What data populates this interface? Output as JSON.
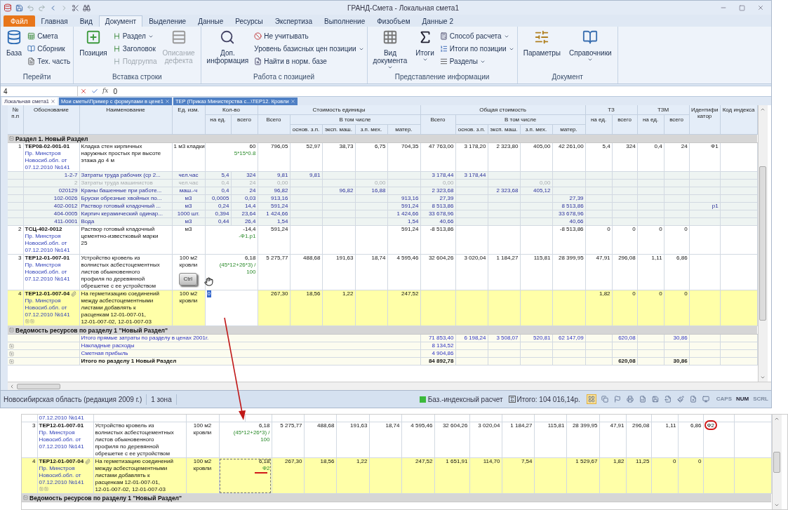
{
  "window": {
    "title": "ГРАНД-Смета - Локальная смета1"
  },
  "file_menu": {
    "label": "Файл"
  },
  "menu_tabs": [
    {
      "label": "Главная",
      "selected": false
    },
    {
      "label": "Вид",
      "selected": false
    },
    {
      "label": "Документ",
      "selected": true
    },
    {
      "label": "Выделение",
      "selected": false
    },
    {
      "label": "Данные",
      "selected": false
    },
    {
      "label": "Ресурсы",
      "selected": false
    },
    {
      "label": "Экспертиза",
      "selected": false
    },
    {
      "label": "Выполнение",
      "selected": false
    },
    {
      "label": "Физобъем",
      "selected": false
    },
    {
      "label": "Данные 2",
      "selected": false
    }
  ],
  "ribbon": [
    {
      "title": "Перейти",
      "large": [
        {
          "label": [
            "База"
          ],
          "disabled": false,
          "dropdown": false
        }
      ],
      "small": [
        {
          "label": "Смета",
          "disabled": false,
          "dropdown": false
        },
        {
          "label": "Сборник",
          "disabled": false,
          "dropdown": false
        },
        {
          "label": "Тех. часть",
          "disabled": false,
          "dropdown": false
        }
      ]
    },
    {
      "title": "Вставка строки",
      "large": [
        {
          "label": [
            "Позиция"
          ],
          "disabled": false,
          "dropdown": false
        }
      ],
      "small": [
        {
          "label": "Раздел",
          "disabled": false,
          "dropdown": true
        },
        {
          "label": "Заголовок",
          "disabled": false,
          "dropdown": false
        },
        {
          "label": "Подгруппа",
          "disabled": true,
          "dropdown": false
        }
      ],
      "large_after": [
        {
          "label": [
            "Описание",
            "дефекта"
          ],
          "disabled": true,
          "dropdown": false
        }
      ]
    },
    {
      "title": "Работа с позицией",
      "large": [
        {
          "label": [
            "Доп.",
            "информация"
          ],
          "disabled": false,
          "dropdown": false
        }
      ],
      "small": [
        {
          "label": "Не учитывать",
          "disabled": false,
          "dropdown": false
        },
        {
          "label": "Уровень базисных цен позиции",
          "disabled": false,
          "dropdown": true
        },
        {
          "label": "Найти в норм. базе",
          "disabled": false,
          "dropdown": false
        }
      ]
    },
    {
      "title": "Представление информации",
      "large": [
        {
          "label": [
            "Вид",
            "документа"
          ],
          "disabled": false,
          "dropdown": true
        },
        {
          "label": [
            "Итоги"
          ],
          "disabled": false,
          "dropdown": true
        }
      ],
      "small": [
        {
          "label": "Способ расчета",
          "disabled": false,
          "dropdown": true
        },
        {
          "label": "Итоги по позиции",
          "disabled": false,
          "dropdown": true
        },
        {
          "label": "Разделы",
          "disabled": false,
          "dropdown": true
        }
      ]
    },
    {
      "title": "Документ",
      "large": [
        {
          "label": [
            "Параметры"
          ],
          "disabled": false,
          "dropdown": false
        },
        {
          "label": [
            "Справочники"
          ],
          "disabled": false,
          "dropdown": true
        }
      ]
    }
  ],
  "formula_bar": {
    "cell": "4",
    "function_label": "fx",
    "value": "0"
  },
  "doc_tabs": [
    {
      "label": "Локальная смета1",
      "selected": true
    },
    {
      "label": "Мои сметы\\Пример с формулами в цене1",
      "selected": false
    },
    {
      "label": "ТЕР (Приказ Министерства с...\\ТЕР12. Кровли",
      "selected": false
    }
  ],
  "header": {
    "num": "№ п.п",
    "basis": "Обоснование",
    "name": "Наименование",
    "unit": "Ед. изм.",
    "qty": {
      "label": "Кол-во",
      "sub": [
        "на ед.",
        "всего"
      ]
    },
    "unit_cost": {
      "label": "Стоимость единицы",
      "total": "Всего",
      "incl": "В том числе",
      "sub": [
        "основ. з.п.",
        "эксп. маш.",
        "з.п. мех.",
        "матер."
      ]
    },
    "total_cost": {
      "label": "Общая стоимость",
      "total": "Всего",
      "incl": "В том числе",
      "sub": [
        "основ. з.п.",
        "эксп. маш.",
        "з.п. мех.",
        "матер."
      ]
    },
    "tz": {
      "label": "ТЗ",
      "sub": [
        "на ед.",
        "всего"
      ]
    },
    "tzm": {
      "label": "ТЗМ",
      "sub": [
        "на ед.",
        "всего"
      ]
    },
    "ident": [
      "Идентифи",
      "катор"
    ],
    "code": "Код индекса"
  },
  "main": {
    "rows": [
      {
        "kind": "section",
        "label": "Раздел 1. Новый Раздел",
        "selected": false
      },
      {
        "kind": "item",
        "selected": false,
        "num": "1",
        "code": "ТЕР08-02-001-01",
        "source": [
          "Пр. Минстроя",
          "Новосиб.обл. от",
          "07.12.2010 №141"
        ],
        "name": [
          "Кладка стен кирпичных",
          "наружных простых при высоте",
          "этажа до 4 м"
        ],
        "unit": [
          "1 м3 кладки"
        ],
        "qt": "60",
        "formula": [
          "5*15*0.8"
        ],
        "v": {
          "ut": "796,05",
          "uo": "52,97",
          "ue": "38,73",
          "uz": "6,75",
          "um": "704,35",
          "tt": "47 763,00",
          "to": "3 178,20",
          "te": "2 323,80",
          "tz": "405,00",
          "tm": "42 261,00",
          "zu": "5,4",
          "zt": "324",
          "mu": "0,4",
          "mt": "24",
          "id": "Ф1"
        }
      },
      {
        "kind": "resource",
        "selected": false,
        "disabled": false,
        "code": "1-2-7",
        "name": "Затраты труда рабочих (ср 2...",
        "unit": "чел.час",
        "v": {
          "qu": "5,4",
          "qt": "324",
          "ut": "9,81",
          "uo": "9,81",
          "tt": "3 178,44",
          "to": "3 178,44"
        }
      },
      {
        "kind": "resource",
        "selected": false,
        "disabled": true,
        "code": "2",
        "name": "Затраты труда машинистов",
        "unit": "чел.час",
        "v": {
          "qu": "0,4",
          "qt": "24",
          "ut": "0,00",
          "uz": "0,00",
          "tt": "0,00",
          "tz": "0,00"
        }
      },
      {
        "kind": "resource",
        "selected": false,
        "disabled": false,
        "code": "020129",
        "name": "Краны башенные при работе...",
        "unit": "маш.-ч",
        "v": {
          "qu": "0,4",
          "qt": "24",
          "ut": "96,82",
          "ue": "96,82",
          "uz": "16,88",
          "tt": "2 323,68",
          "te": "2 323,68",
          "tz": "405,12"
        }
      },
      {
        "kind": "resource",
        "selected": false,
        "disabled": false,
        "code": "102-0026",
        "name": "Бруски обрезные хвойных по...",
        "unit": "м3",
        "v": {
          "qu": "0,0005",
          "qt": "0,03",
          "ut": "913,16",
          "um": "913,16",
          "tt": "27,39",
          "tm": "27,39"
        }
      },
      {
        "kind": "resource",
        "selected": false,
        "disabled": false,
        "code": "402-0012",
        "name": "Раствор готовый кладочный ...",
        "unit": "м3",
        "v": {
          "qu": "0,24",
          "qt": "14,4",
          "ut": "591,24",
          "um": "591,24",
          "tt": "8 513,86",
          "tm": "8 513,86",
          "id": "р1"
        }
      },
      {
        "kind": "resource",
        "selected": false,
        "disabled": false,
        "code": "404-0005",
        "name": "Кирпич керамический одинар...",
        "unit": "1000 шт.",
        "v": {
          "qu": "0,394",
          "qt": "23,64",
          "ut": "1 424,66",
          "um": "1 424,66",
          "tt": "33 678,96",
          "tm": "33 678,96"
        }
      },
      {
        "kind": "resource",
        "selected": false,
        "disabled": false,
        "code": "411-0001",
        "name": "Вода",
        "unit": "м3",
        "v": {
          "qu": "0,44",
          "qt": "26,4",
          "ut": "1,54",
          "um": "1,54",
          "tt": "40,66",
          "tm": "40,66"
        }
      },
      {
        "kind": "item",
        "selected": false,
        "num": "2",
        "code": "ТСЦ-402-0012",
        "source": [
          "Пр. Минстроя",
          "Новосиб.обл. от",
          "07.12.2010 №141"
        ],
        "name": [
          "Раствор готовый кладочный",
          "цементно-известковый марки",
          "25"
        ],
        "unit": [
          "м3"
        ],
        "qt": "-14,4",
        "formula": [
          "-Ф1.р1"
        ],
        "v": {
          "ut": "591,24",
          "um": "591,24",
          "tt": "-8 513,86",
          "tm": "-8 513,86",
          "zu": "0",
          "zt": "0",
          "mu": "0",
          "mt": "0"
        }
      },
      {
        "kind": "item",
        "selected": false,
        "num": "3",
        "code": "ТЕР12-01-007-01",
        "source": [
          "Пр. Минстроя",
          "Новосиб.обл. от",
          "07.12.2010 №141"
        ],
        "name": [
          "Устройство кровель из",
          "волнистых асбестоцементных",
          "листов обыкновенного",
          "профиля по деревянной",
          "обрешетке с ее устройством"
        ],
        "unit": [
          "100 м2",
          "кровли"
        ],
        "qt": "6,18",
        "formula": [
          "(45*12+26*3) /",
          "100"
        ],
        "key_overlay": "Ctrl",
        "v": {
          "ut": "5 275,77",
          "uo": "488,68",
          "ue": "191,63",
          "uz": "18,74",
          "um": "4 595,46",
          "tt": "32 604,26",
          "to": "3 020,04",
          "te": "1 184,27",
          "tz": "115,81",
          "tm": "28 399,95",
          "zu": "47,91",
          "zt": "296,08",
          "mu": "1,11",
          "mt": "6,86"
        }
      },
      {
        "kind": "item",
        "selected": true,
        "attachment": true,
        "expanders": true,
        "num": "4",
        "code": "ТЕР12-01-007-04",
        "source": [
          "Пр. Минстроя",
          "Новосиб.обл. от",
          "07.12.2010 №141"
        ],
        "name": [
          "На герметизацию соединений",
          "между асбестоцементными",
          "листами добавлять к",
          "расценкам 12-01-007-01,",
          "12-01-007-02, 12-01-007-03"
        ],
        "unit": [
          "100 м2",
          "кровли"
        ],
        "editing": "0",
        "v": {
          "ut": "267,30",
          "uo": "18,56",
          "ue": "1,22",
          "um": "247,52",
          "zu": "1,82",
          "zt": "0",
          "mu": "0",
          "mt": "0"
        }
      },
      {
        "kind": "group",
        "label": "Ведомость ресурсов по разделу 1 \"Новый Раздел\"",
        "selected": false
      },
      {
        "kind": "sum",
        "selected": false,
        "expandable": false,
        "bold": false,
        "label": "Итого прямые затраты по разделу в ценах 2001г.",
        "v": {
          "tt": "71 853,40",
          "to": "6 198,24",
          "te": "3 508,07",
          "tz": "520,81",
          "tm": "62 147,09",
          "zt": "620,08",
          "mt": "30,86"
        }
      },
      {
        "kind": "sum",
        "selected": false,
        "expandable": true,
        "bold": false,
        "label": "Накладные расходы",
        "v": {
          "tt": "8 134,52"
        }
      },
      {
        "kind": "sum",
        "selected": false,
        "expandable": true,
        "bold": false,
        "label": "Сметная прибыль",
        "v": {
          "tt": "4 904,86"
        }
      },
      {
        "kind": "sum",
        "selected": false,
        "expandable": true,
        "bold": true,
        "label": "Итого по разделу 1 Новый Раздел",
        "v": {
          "tt": "84 892,78",
          "zt": "620,08",
          "mt": "30,86"
        }
      }
    ]
  },
  "status_bar": {
    "region": "Новосибирская область (редакция 2009 г.)",
    "zone": "1 зона",
    "mode": "Баз.-индексный расчет",
    "total": "Итого: 104 016,14р.",
    "locks": [
      {
        "label": "CAPS",
        "on": false
      },
      {
        "label": "NUM",
        "on": true
      },
      {
        "label": "SCRL",
        "on": false
      }
    ]
  },
  "inset": {
    "rows": [
      {
        "kind": "tail",
        "selected": false,
        "source": [
          "07.12.2010 №141"
        ]
      },
      {
        "kind": "item",
        "selected": false,
        "num": "3",
        "code": "ТЕР12-01-007-01",
        "source": [
          "Пр. Минстроя",
          "Новосиб.обл. от",
          "07.12.2010 №141"
        ],
        "name": [
          "Устройство кровель из",
          "волнистых асбестоцементных",
          "листов обыкновенного",
          "профиля по деревянной",
          "обрешетке с ее устройством"
        ],
        "unit": [
          "100 м2",
          "кровли"
        ],
        "qt": "6,18",
        "formula": [
          "(45*12+26*3) /",
          "100"
        ],
        "id_circled": true,
        "v": {
          "ut": "5 275,77",
          "uo": "488,68",
          "ue": "191,63",
          "uz": "18,74",
          "um": "4 595,46",
          "tt": "32 604,26",
          "to": "3 020,04",
          "te": "1 184,27",
          "tz": "115,81",
          "tm": "28 399,95",
          "zu": "47,91",
          "zt": "296,08",
          "mu": "1,11",
          "mt": "6,86",
          "id": "Ф2"
        }
      },
      {
        "kind": "item",
        "selected": true,
        "attachment": true,
        "expanders": true,
        "focused": true,
        "underlined": true,
        "num": "4",
        "code": "ТЕР12-01-007-04",
        "source": [
          "Пр. Минстроя",
          "Новосиб.обл. от",
          "07.12.2010 №141"
        ],
        "name": [
          "На герметизацию соединений",
          "между асбестоцементными",
          "листами добавлять к",
          "расценкам 12-01-007-01,",
          "12-01-007-02, 12-01-007-03"
        ],
        "unit": [
          "100 м2",
          "кровли"
        ],
        "qt": "6,18",
        "formula": [
          "Ф2"
        ],
        "v": {
          "ut": "267,30",
          "uo": "18,56",
          "ue": "1,22",
          "um": "247,52",
          "tt": "1 651,91",
          "to": "114,70",
          "te": "7,54",
          "tm": "1 529,67",
          "zu": "1,82",
          "zt": "11,25",
          "mu": "0",
          "mt": "0"
        }
      },
      {
        "kind": "group",
        "label": "Ведомость ресурсов по разделу 1 \"Новый Раздел\"",
        "selected": false
      }
    ]
  }
}
